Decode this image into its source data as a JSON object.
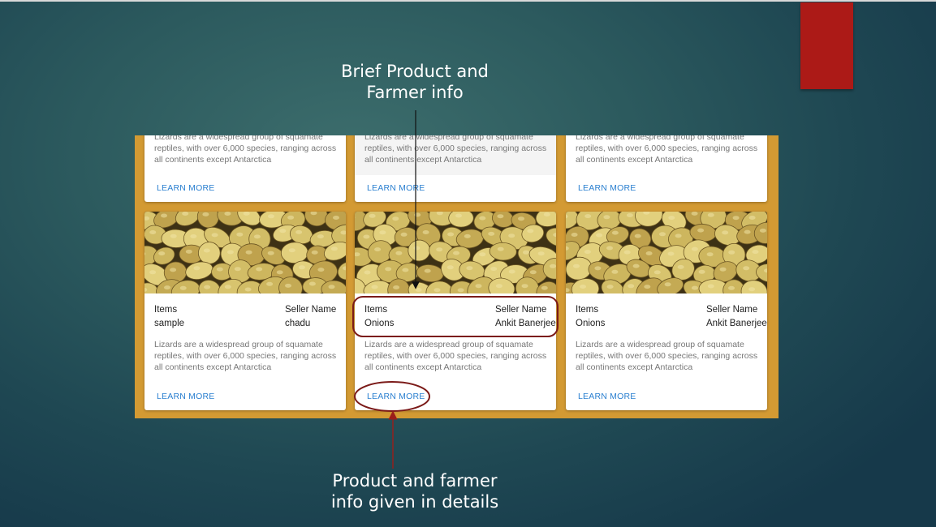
{
  "annotations": {
    "top": "Brief Product and\nFarmer info",
    "bottom": "Product and farmer\ninfo given in details"
  },
  "top_row": [
    {
      "description": "Lizards are a widespread group of squamate reptiles, with over 6,000 species, ranging across all continents except Antarctica",
      "link": "LEARN MORE"
    },
    {
      "description": "Lizards are a widespread group of squamate reptiles, with over 6,000 species, ranging across all continents except Antarctica",
      "link": "LEARN MORE"
    },
    {
      "description": "Lizards are a widespread group of squamate reptiles, with over 6,000 species, ranging across all continents except Antarctica",
      "link": "LEARN MORE"
    }
  ],
  "cards": [
    {
      "items_label": "Items",
      "item": "sample",
      "seller_label": "Seller Name",
      "seller": "chadu",
      "description": "Lizards are a widespread group of squamate reptiles, with over 6,000 species, ranging across all continents except Antarctica",
      "link": "LEARN MORE"
    },
    {
      "items_label": "Items",
      "item": "Onions",
      "seller_label": "Seller Name",
      "seller": "Ankit Banerjee",
      "description": "Lizards are a widespread group of squamate reptiles, with over 6,000 species, ranging across all continents except Antarctica",
      "link": "LEARN MORE"
    },
    {
      "items_label": "Items",
      "item": "Onions",
      "seller_label": "Seller Name",
      "seller": "Ankit Banerjee",
      "description": "Lizards are a widespread group of squamate reptiles, with over 6,000 species, ranging across all continents except Antarctica",
      "link": "LEARN MORE"
    }
  ],
  "colors": {
    "panel": "#d39a33",
    "accent_red": "#ac1a17",
    "link": "#2a7fd0",
    "callout": "#7b1a18"
  }
}
